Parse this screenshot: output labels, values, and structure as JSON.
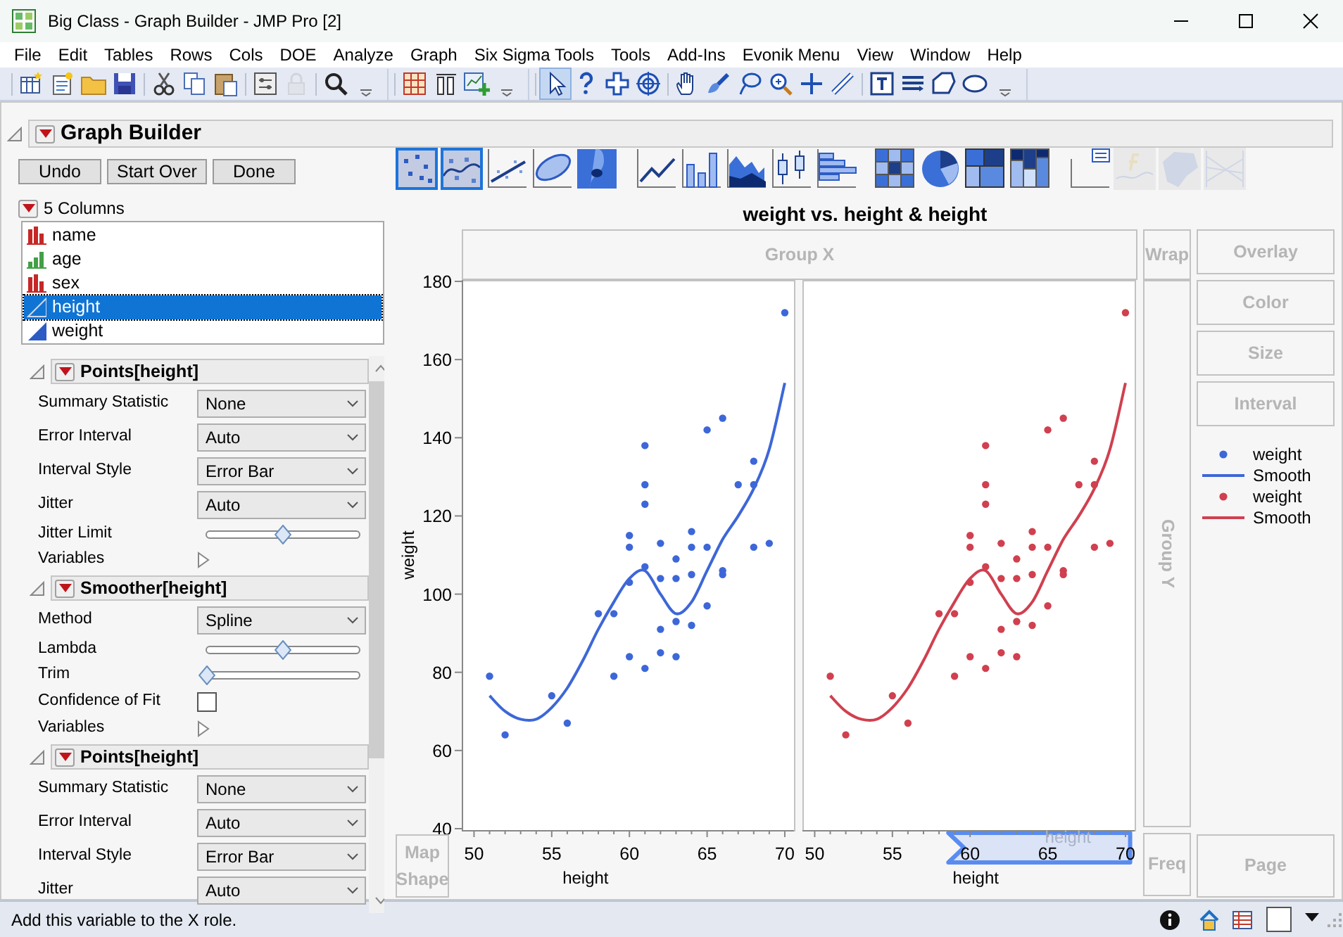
{
  "window": {
    "title": "Big Class - Graph Builder - JMP Pro [2]"
  },
  "menu": [
    "File",
    "Edit",
    "Tables",
    "Rows",
    "Cols",
    "DOE",
    "Analyze",
    "Graph",
    "Six Sigma Tools",
    "Tools",
    "Add-Ins",
    "Evonik Menu",
    "View",
    "Window",
    "Help"
  ],
  "toolbar": {
    "tools": [
      {
        "selected": false,
        "disabled": false
      },
      {
        "selected": false,
        "disabled": false
      },
      {
        "selected": false,
        "disabled": false
      },
      {
        "selected": false,
        "disabled": false
      },
      {
        "selected": false,
        "disabled": false
      },
      {
        "selected": false,
        "disabled": false
      },
      {
        "selected": false,
        "disabled": false
      },
      {
        "selected": false,
        "disabled": false
      },
      {
        "selected": false,
        "disabled": true
      },
      {
        "selected": false,
        "disabled": false
      },
      {
        "selected": false,
        "disabled": false
      },
      {
        "selected": false,
        "disabled": false
      },
      {
        "selected": false,
        "disabled": false
      },
      {
        "selected": false,
        "disabled": false
      },
      {
        "selected": false,
        "disabled": false
      },
      {
        "selected": true,
        "disabled": false
      },
      {
        "selected": false,
        "disabled": false
      },
      {
        "selected": false,
        "disabled": false
      },
      {
        "selected": false,
        "disabled": false
      },
      {
        "selected": false,
        "disabled": false
      },
      {
        "selected": false,
        "disabled": false
      },
      {
        "selected": false,
        "disabled": false
      },
      {
        "selected": false,
        "disabled": false
      },
      {
        "selected": false,
        "disabled": false
      },
      {
        "selected": false,
        "disabled": false
      },
      {
        "selected": false,
        "disabled": false
      },
      {
        "selected": false,
        "disabled": false
      },
      {
        "selected": false,
        "disabled": false
      },
      {
        "selected": false,
        "disabled": false
      },
      {
        "selected": false,
        "disabled": false
      }
    ]
  },
  "graph_builder": {
    "title": "Graph Builder",
    "buttons": [
      "Undo",
      "Start Over",
      "Done"
    ],
    "columns_header": "5 Columns",
    "columns": [
      {
        "name": "name",
        "kind": "nominal",
        "selected": false
      },
      {
        "name": "age",
        "kind": "ordinal",
        "selected": false
      },
      {
        "name": "sex",
        "kind": "nominal",
        "selected": false
      },
      {
        "name": "height",
        "kind": "continuous",
        "selected": true
      },
      {
        "name": "weight",
        "kind": "continuous",
        "selected": false
      }
    ],
    "sections": [
      {
        "title": "Points[height]",
        "rows": [
          {
            "kind": "select",
            "label": "Summary Statistic",
            "value": "None"
          },
          {
            "kind": "select",
            "label": "Error Interval",
            "value": "Auto"
          },
          {
            "kind": "select",
            "label": "Interval Style",
            "value": "Error Bar"
          },
          {
            "kind": "select",
            "label": "Jitter",
            "value": "Auto"
          },
          {
            "kind": "slider",
            "label": "Jitter Limit",
            "level": 0.5
          },
          {
            "kind": "disclosure",
            "label": "Variables"
          }
        ]
      },
      {
        "title": "Smoother[height]",
        "rows": [
          {
            "kind": "select",
            "label": "Method",
            "value": "Spline"
          },
          {
            "kind": "slider",
            "label": "Lambda",
            "level": 0.5
          },
          {
            "kind": "slider",
            "label": "Trim",
            "level": 0
          },
          {
            "kind": "checkbox",
            "label": "Confidence of Fit",
            "checked": false
          },
          {
            "kind": "disclosure",
            "label": "Variables"
          }
        ]
      },
      {
        "title": "Points[height]",
        "rows": [
          {
            "kind": "select",
            "label": "Summary Statistic",
            "value": "None"
          },
          {
            "kind": "select",
            "label": "Error Interval",
            "value": "Auto"
          },
          {
            "kind": "select",
            "label": "Interval Style",
            "value": "Error Bar"
          },
          {
            "kind": "select",
            "label": "Jitter",
            "value": "Auto"
          }
        ]
      }
    ]
  },
  "graph": {
    "element_types": [
      {
        "selected": true,
        "disabled": false
      },
      {
        "selected": true,
        "disabled": false
      },
      {
        "selected": false,
        "disabled": false
      },
      {
        "selected": false,
        "disabled": false
      },
      {
        "selected": false,
        "disabled": false
      },
      {
        "selected": false,
        "disabled": false
      },
      {
        "selected": false,
        "disabled": false
      },
      {
        "selected": false,
        "disabled": false
      },
      {
        "selected": false,
        "disabled": false
      },
      {
        "selected": false,
        "disabled": false
      },
      {
        "selected": false,
        "disabled": false
      },
      {
        "selected": false,
        "disabled": false
      },
      {
        "selected": false,
        "disabled": false
      },
      {
        "selected": false,
        "disabled": false
      },
      {
        "selected": false,
        "disabled": false
      },
      {
        "selected": false,
        "disabled": true
      },
      {
        "selected": false,
        "disabled": true
      },
      {
        "selected": false,
        "disabled": true
      }
    ],
    "title": "weight vs. height & height",
    "zones": {
      "group_x": "Group X",
      "wrap": "Wrap",
      "overlay": "Overlay",
      "color_role": "Color",
      "size": "Size",
      "interval": "Interval",
      "group_y": "Group Y",
      "map_shape": "Map Shape",
      "freq": "Freq",
      "page": "Page"
    },
    "panels": [
      {
        "chart_data": {
          "type": "scatter",
          "xlabel": "height",
          "ylabel": "weight",
          "xlim": [
            49.3,
            70.5
          ],
          "ylim": [
            40,
            180
          ],
          "xticks": [
            50,
            55,
            60,
            65,
            70
          ],
          "yticks": [
            40,
            60,
            80,
            100,
            120,
            140,
            160,
            180
          ],
          "series": [
            {
              "type": "scatter",
              "color": "#3d67d8",
              "x": [
                51,
                52,
                55,
                56,
                58,
                59,
                59,
                60,
                60,
                60,
                60,
                61,
                61,
                61,
                61,
                61,
                62,
                62,
                62,
                62,
                63,
                63,
                63,
                63,
                64,
                64,
                64,
                64,
                65,
                65,
                65,
                66,
                66,
                66,
                67,
                68,
                68,
                68,
                69,
                70
              ],
              "values": [
                79,
                64,
                74,
                67,
                95,
                95,
                79,
                115,
                112,
                103,
                84,
                138,
                128,
                123,
                107,
                81,
                104,
                91,
                85,
                113,
                109,
                93,
                84,
                104,
                116,
                105,
                92,
                112,
                142,
                112,
                97,
                145,
                106,
                105,
                128,
                134,
                128,
                112,
                113,
                172
              ]
            },
            {
              "type": "line",
              "color": "#3d67d8",
              "x": [
                51,
                52,
                53,
                54,
                55,
                56,
                57,
                58,
                59,
                60,
                61,
                62,
                63,
                64,
                65,
                66,
                67,
                68,
                69,
                70
              ],
              "values": [
                74,
                70,
                68,
                68,
                71,
                76,
                83,
                91,
                98,
                104,
                106,
                100,
                95,
                98,
                106,
                114,
                120,
                127,
                137,
                154
              ]
            }
          ]
        }
      },
      {
        "chart_data": {
          "type": "scatter",
          "xlabel": "height",
          "xlim": [
            49.3,
            70.5
          ],
          "ylim": [
            40,
            180
          ],
          "xticks": [
            50,
            55,
            60,
            65,
            70
          ],
          "series": [
            {
              "type": "scatter",
              "color": "#d0404f",
              "x": [
                51,
                52,
                55,
                56,
                58,
                59,
                59,
                60,
                60,
                60,
                60,
                61,
                61,
                61,
                61,
                61,
                62,
                62,
                62,
                62,
                63,
                63,
                63,
                63,
                64,
                64,
                64,
                64,
                65,
                65,
                65,
                66,
                66,
                66,
                67,
                68,
                68,
                68,
                69,
                70
              ],
              "values": [
                79,
                64,
                74,
                67,
                95,
                95,
                79,
                115,
                112,
                103,
                84,
                138,
                128,
                123,
                107,
                81,
                104,
                91,
                85,
                113,
                109,
                93,
                84,
                104,
                116,
                105,
                92,
                112,
                142,
                112,
                97,
                145,
                106,
                105,
                128,
                134,
                128,
                112,
                113,
                172
              ]
            },
            {
              "type": "line",
              "color": "#d0404f",
              "x": [
                51,
                52,
                53,
                54,
                55,
                56,
                57,
                58,
                59,
                60,
                61,
                62,
                63,
                64,
                65,
                66,
                67,
                68,
                69,
                70
              ],
              "values": [
                74,
                70,
                68,
                68,
                71,
                76,
                83,
                91,
                98,
                104,
                106,
                100,
                95,
                98,
                106,
                114,
                120,
                127,
                137,
                154
              ]
            }
          ]
        }
      }
    ],
    "drop_hint": "height",
    "legend": [
      {
        "kind": "point",
        "label": "weight",
        "color": "#3d67d8"
      },
      {
        "kind": "line",
        "label": "Smooth",
        "color": "#3d67d8"
      },
      {
        "kind": "point",
        "label": "weight",
        "color": "#d0404f"
      },
      {
        "kind": "line",
        "label": "Smooth",
        "color": "#d0404f"
      }
    ]
  },
  "status_bar": {
    "message": "Add this variable to the X role."
  }
}
